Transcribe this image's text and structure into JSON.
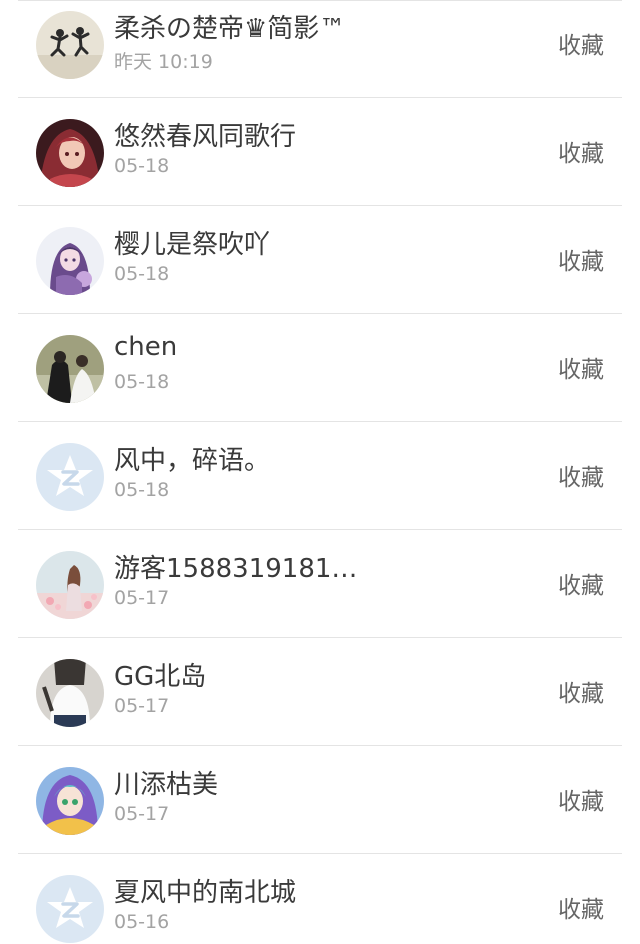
{
  "favorite_label": "收藏",
  "items": [
    {
      "name": "柔杀の楚帝♛简影™",
      "time": "昨天 10:19",
      "avatar": "photo-two-people-jumping"
    },
    {
      "name": "悠然春风同歌行",
      "time": "05-18",
      "avatar": "anime-girl-red"
    },
    {
      "name": "樱儿是祭吹吖",
      "time": "05-18",
      "avatar": "anime-girl-purple"
    },
    {
      "name": "chen",
      "time": "05-18",
      "avatar": "photo-couple"
    },
    {
      "name": "风中，碎语。",
      "time": "05-18",
      "avatar": "default-qzone-star"
    },
    {
      "name": "游客1588319181…",
      "time": "05-17",
      "avatar": "photo-girl-flowers"
    },
    {
      "name": "GG北岛",
      "time": "05-17",
      "avatar": "photo-girl-white-shirt"
    },
    {
      "name": "川添枯美",
      "time": "05-17",
      "avatar": "anime-girl-colorful"
    },
    {
      "name": "夏风中的南北城",
      "time": "05-16",
      "avatar": "default-qzone-star"
    }
  ],
  "colors": {
    "name_text": "#3a3a3a",
    "time_text": "#a3a3a3",
    "favorite_text": "#666666",
    "divider": "#e4e4e4",
    "default_avatar_bg": "#dbe7f3",
    "default_avatar_star": "#ffffff"
  }
}
